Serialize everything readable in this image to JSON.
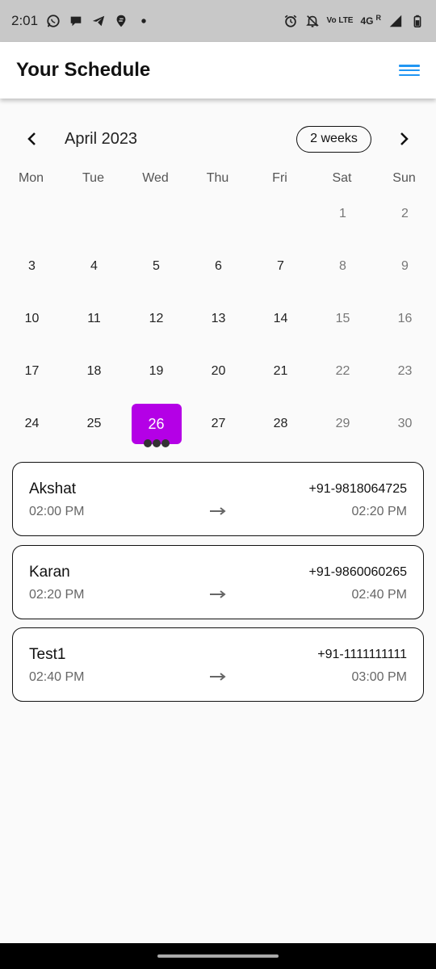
{
  "status_bar": {
    "time": "2:01",
    "network_text": "4G",
    "volte_text": "Vo LTE",
    "roaming_text": "R",
    "icons": [
      "whatsapp-icon",
      "chat-icon",
      "telegram-icon",
      "swiggy-icon",
      "dot-icon",
      "alarm-icon",
      "bell-off-icon",
      "signal-icon",
      "battery-icon"
    ]
  },
  "app_bar": {
    "title": "Your Schedule",
    "menu_icon": "hamburger-menu-icon",
    "accent": "#2196f3"
  },
  "calendar": {
    "month_label": "April 2023",
    "format_button": "2 weeks",
    "prev_icon": "chevron-left-icon",
    "next_icon": "chevron-right-icon",
    "weekdays": [
      "Mon",
      "Tue",
      "Wed",
      "Thu",
      "Fri",
      "Sat",
      "Sun"
    ],
    "weeks": [
      [
        "",
        "",
        "",
        "",
        "",
        "1",
        "2"
      ],
      [
        "3",
        "4",
        "5",
        "6",
        "7",
        "8",
        "9"
      ],
      [
        "10",
        "11",
        "12",
        "13",
        "14",
        "15",
        "16"
      ],
      [
        "17",
        "18",
        "19",
        "20",
        "21",
        "22",
        "23"
      ],
      [
        "24",
        "25",
        "26",
        "27",
        "28",
        "29",
        "30"
      ]
    ],
    "selected_day": "26",
    "selected_color": "#b400e6",
    "selected_event_count": 3
  },
  "appointments": [
    {
      "name": "Akshat",
      "phone": "+91-9818064725",
      "start": "02:00 PM",
      "end": "02:20 PM"
    },
    {
      "name": "Karan",
      "phone": "+91-9860060265",
      "start": "02:20 PM",
      "end": "02:40 PM"
    },
    {
      "name": "Test1",
      "phone": "+91-1111111111",
      "start": "02:40 PM",
      "end": "03:00 PM"
    }
  ]
}
